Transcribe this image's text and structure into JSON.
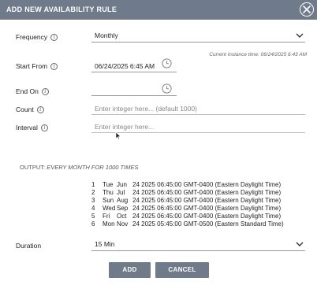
{
  "dialog": {
    "title": "ADD NEW AVAILABILITY RULE"
  },
  "frequency": {
    "label": "Frequency",
    "value": "Monthly"
  },
  "instance_time": "Current instance time: 06/24/2025 6:43 AM",
  "start_on": {
    "label": "Start From",
    "value": "06/24/2025 6:45 AM"
  },
  "end_on": {
    "label": "End On",
    "value": ""
  },
  "count": {
    "label": "Count",
    "placeholder": "Enter integer here... (default 1000)"
  },
  "interval": {
    "label": "Interval",
    "placeholder": "Enter integer here..."
  },
  "output": {
    "prefix": "OUTPUT:",
    "summary": "EVERY MONTH FOR 1000 TIMES"
  },
  "occurrences": [
    {
      "n": "1",
      "dow": "Tue",
      "mon": "Jun",
      "rest": "24 2025 06:45:00 GMT-0400 (Eastern Daylight  Time)"
    },
    {
      "n": "2",
      "dow": "Thu",
      "mon": "Jul",
      "rest": "24 2025 06:45:00 GMT-0400 (Eastern Daylight  Time)"
    },
    {
      "n": "3",
      "dow": "Sun",
      "mon": "Aug",
      "rest": "24 2025 06:45:00 GMT-0400 (Eastern Daylight  Time)"
    },
    {
      "n": "4",
      "dow": "Wed",
      "mon": "Sep",
      "rest": "24 2025 06:45:00 GMT-0400 (Eastern Daylight  Time)"
    },
    {
      "n": "5",
      "dow": "Fri",
      "mon": "Oct",
      "rest": "24 2025 06:45:00 GMT-0400 (Eastern Daylight  Time)"
    },
    {
      "n": "6",
      "dow": "Mon",
      "mon": "Nov",
      "rest": "24 2025 05:45:00 GMT-0500 (Eastern Standard Time)"
    }
  ],
  "duration": {
    "label": "Duration",
    "value": "15 Min"
  },
  "buttons": {
    "add": "ADD",
    "cancel": "CANCEL"
  },
  "colors": {
    "header": "#6f7a8a",
    "button": "#6f7a8a"
  },
  "icons": {
    "close": "close-circle-icon",
    "info": "info-icon",
    "clock": "clock-icon",
    "chevron": "chevron-down-icon"
  }
}
